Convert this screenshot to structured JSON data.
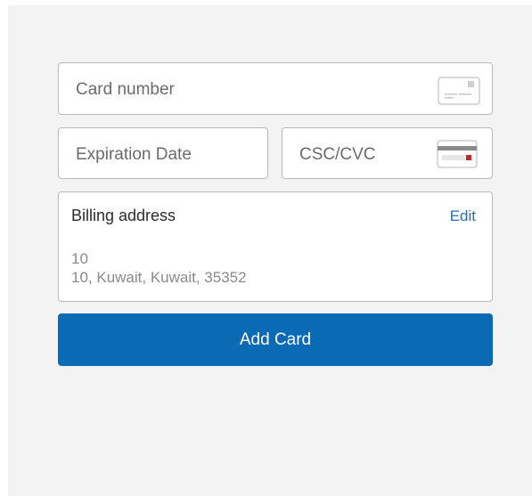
{
  "card_form": {
    "card_number_placeholder": "Card number",
    "card_icon": "generic-card-icon",
    "expiration_placeholder": "Expiration Date",
    "csc_placeholder": "CSC/CVC",
    "csc_icon": "card-back-csc-icon"
  },
  "billing": {
    "title": "Billing address",
    "edit_label": "Edit",
    "line1": "10",
    "line2": "10, Kuwait, Kuwait, 35352"
  },
  "actions": {
    "add_card_label": "Add Card"
  },
  "colors": {
    "accent": "#0a6ab4",
    "link": "#1e6fb5",
    "background": "#f3f3f3"
  }
}
